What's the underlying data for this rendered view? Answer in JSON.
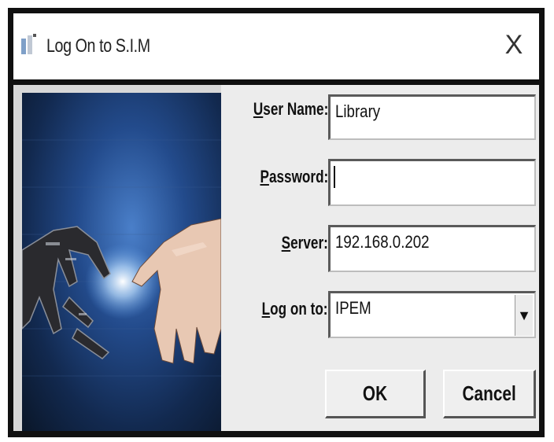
{
  "window": {
    "title": "Log On to S.I.M",
    "close_label": "X"
  },
  "form": {
    "user_name_label_key": "U",
    "user_name_label_rest": "ser Name:",
    "user_name_value": "Library",
    "password_label_key": "P",
    "password_label_rest": "assword:",
    "password_value": "",
    "server_label_key": "S",
    "server_label_rest": "erver:",
    "server_value": "192.168.0.202",
    "logon_label_key": "L",
    "logon_label_rest": "og on to:",
    "logon_value": "IPEM"
  },
  "buttons": {
    "ok": "OK",
    "cancel": "Cancel"
  },
  "icons": {
    "app": "app-icon",
    "close": "close-icon",
    "dropdown": "triangle-down-icon"
  }
}
